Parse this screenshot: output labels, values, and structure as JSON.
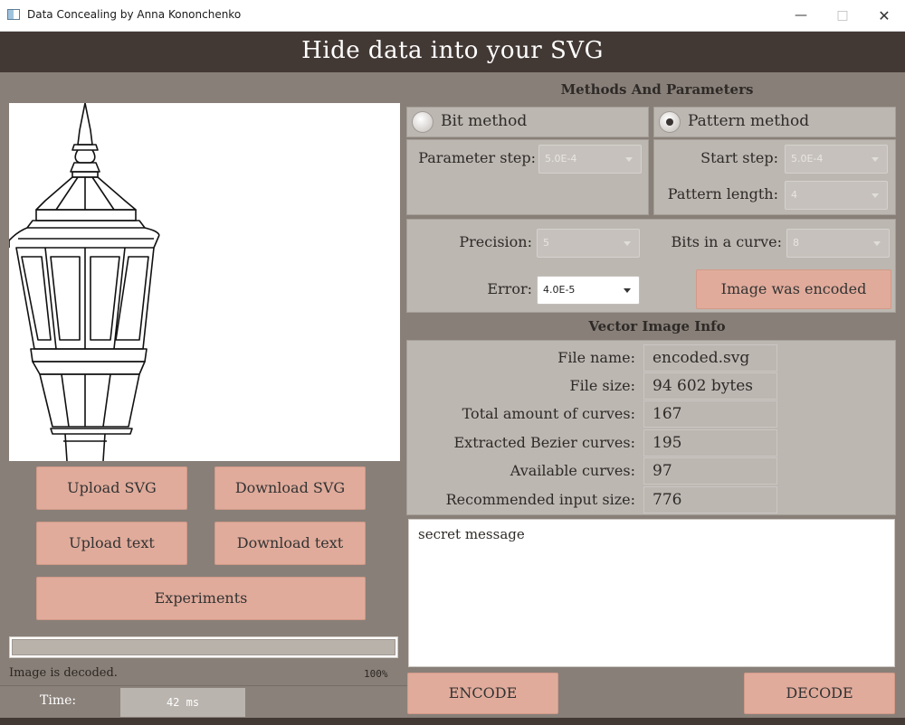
{
  "window": {
    "title": "Data Concealing by Anna Kononchenko",
    "minimize": "—",
    "maximize": "□",
    "close": "✕"
  },
  "header": {
    "title": "Hide data into your SVG"
  },
  "buttons": {
    "upload_svg": "Upload SVG",
    "download_svg": "Download SVG",
    "upload_text": "Upload text",
    "download_text": "Download text",
    "experiments": "Experiments",
    "encode": "ENCODE",
    "decode": "DECODE"
  },
  "progress": {
    "value": 1.0,
    "percent_label": "100%"
  },
  "status": {
    "text": "Image is decoded."
  },
  "time": {
    "label": "Time:",
    "value": "42 ms"
  },
  "methods": {
    "title": "Methods And Parameters",
    "bit_method": {
      "label": "Bit method",
      "selected": false,
      "param_label": "Parameter step:",
      "param_value": "5.0E-4"
    },
    "pattern_method": {
      "label": "Pattern method",
      "selected": true,
      "start_step_label": "Start step:",
      "start_step_value": "5.0E-4",
      "pattern_length_label": "Pattern length:",
      "pattern_length_value": "4"
    },
    "precision_label": "Precision:",
    "precision_value": "5",
    "bits_label": "Bits in a curve:",
    "bits_value": "8",
    "error_label": "Error:",
    "error_value": "4.0E-5",
    "encoded_status": "Image was encoded"
  },
  "info": {
    "title": "Vector Image Info",
    "rows": [
      {
        "label": "File name:",
        "value": "encoded.svg"
      },
      {
        "label": "File size:",
        "value": "94 602 bytes"
      },
      {
        "label": "Total amount of curves:",
        "value": "167"
      },
      {
        "label": "Extracted Bezier curves:",
        "value": "195"
      },
      {
        "label": "Available curves:",
        "value": "97"
      },
      {
        "label": "Recommended input size:",
        "value": "776"
      }
    ]
  },
  "message": {
    "text": "secret message"
  },
  "colors": {
    "header_bg": "#433934",
    "button": "#e0ab9b",
    "panel": "#bcb7b1",
    "window_bg": "#887f78"
  }
}
